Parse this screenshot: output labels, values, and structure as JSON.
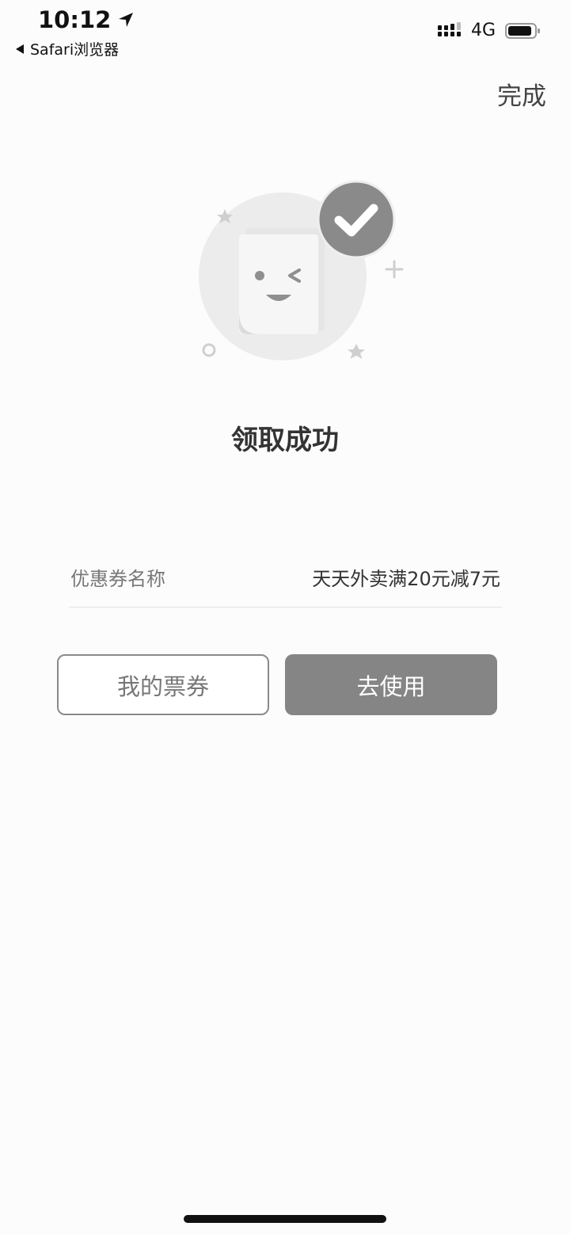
{
  "status_bar": {
    "time": "10:12",
    "back_app": "Safari浏览器",
    "network": "4G",
    "battery_level": 0.9
  },
  "nav": {
    "done_label": "完成"
  },
  "main": {
    "title": "领取成功",
    "coupon": {
      "label": "优惠券名称",
      "value": "天天外卖满20元减7元"
    },
    "buttons": {
      "my_tickets": "我的票券",
      "use_now": "去使用"
    }
  },
  "colors": {
    "background": "#fcfcfc",
    "primary_button": "#858585",
    "badge": "#8a8a8a"
  }
}
